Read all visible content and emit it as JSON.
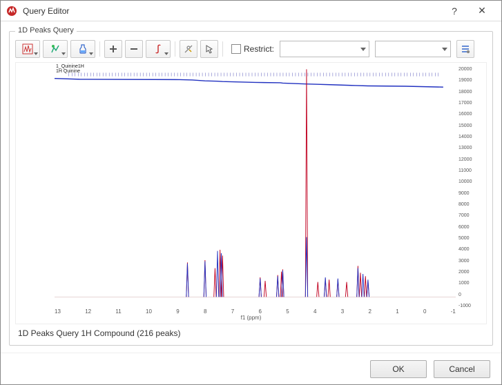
{
  "window": {
    "title": "Query Editor",
    "help_label": "?",
    "close_label": "✕"
  },
  "groupbox": {
    "label": "1D Peaks Query"
  },
  "toolbar": {
    "restrict_label": "Restrict:",
    "combo1_value": "",
    "combo2_value": ""
  },
  "sample": {
    "line1": "1_Quinine1H",
    "line2": "1H Quinine"
  },
  "y_axis_ticks": [
    "20000",
    "19000",
    "18000",
    "17000",
    "16000",
    "15000",
    "14000",
    "13000",
    "12000",
    "11000",
    "10000",
    "9000",
    "8000",
    "7000",
    "6000",
    "5000",
    "4000",
    "3000",
    "2000",
    "1000",
    "0",
    "-1000"
  ],
  "x_axis_ticks": [
    "13",
    "12",
    "11",
    "10",
    "9",
    "8",
    "7",
    "6",
    "5",
    "4",
    "3",
    "2",
    "1",
    "0",
    "-1"
  ],
  "x_axis_label": "f1 (ppm)",
  "status_line": "1D Peaks Query 1H Compound (216 peaks)",
  "footer": {
    "ok": "OK",
    "cancel": "Cancel"
  },
  "icons": {
    "app": "app-logo",
    "spectrum": "spectrum-icon",
    "analyze": "analyze-icon",
    "bottle": "bottle-icon",
    "plus": "plus-icon",
    "minus": "minus-icon",
    "integral": "integral-icon",
    "tools": "tools-icon",
    "cursor": "cursor-icon",
    "list": "list-icon"
  },
  "chart_data": {
    "type": "line",
    "title": "",
    "xlabel": "f1 (ppm)",
    "ylabel": "",
    "xlim": [
      14,
      -2
    ],
    "ylim": [
      -1000,
      20000
    ],
    "series": [
      {
        "name": "1H Quinine (red)",
        "color": "#c00020",
        "peaks": [
          {
            "ppm": 8.7,
            "intensity": 3000
          },
          {
            "ppm": 8.0,
            "intensity": 3200
          },
          {
            "ppm": 7.6,
            "intensity": 2500
          },
          {
            "ppm": 7.4,
            "intensity": 4100
          },
          {
            "ppm": 7.3,
            "intensity": 3600
          },
          {
            "ppm": 5.8,
            "intensity": 1700
          },
          {
            "ppm": 5.6,
            "intensity": 1400
          },
          {
            "ppm": 5.1,
            "intensity": 1900
          },
          {
            "ppm": 4.95,
            "intensity": 2200
          },
          {
            "ppm": 4.9,
            "intensity": 2400
          },
          {
            "ppm": 3.95,
            "intensity": 19800
          },
          {
            "ppm": 3.5,
            "intensity": 1300
          },
          {
            "ppm": 3.2,
            "intensity": 1600
          },
          {
            "ppm": 3.05,
            "intensity": 1500
          },
          {
            "ppm": 2.7,
            "intensity": 1500
          },
          {
            "ppm": 2.35,
            "intensity": 1300
          },
          {
            "ppm": 1.9,
            "intensity": 2700
          },
          {
            "ppm": 1.8,
            "intensity": 2100
          },
          {
            "ppm": 1.6,
            "intensity": 1800
          },
          {
            "ppm": 1.5,
            "intensity": 1400
          }
        ]
      },
      {
        "name": "1_Quinine1H (blue)",
        "color": "#2030c0",
        "peaks": [
          {
            "ppm": 8.7,
            "intensity": 2900
          },
          {
            "ppm": 8.0,
            "intensity": 3100
          },
          {
            "ppm": 7.5,
            "intensity": 4000
          },
          {
            "ppm": 7.35,
            "intensity": 3800
          },
          {
            "ppm": 5.8,
            "intensity": 1600
          },
          {
            "ppm": 5.1,
            "intensity": 1800
          },
          {
            "ppm": 4.9,
            "intensity": 2300
          },
          {
            "ppm": 3.95,
            "intensity": 5200
          },
          {
            "ppm": 3.2,
            "intensity": 1700
          },
          {
            "ppm": 2.7,
            "intensity": 1600
          },
          {
            "ppm": 1.9,
            "intensity": 2500
          },
          {
            "ppm": 1.7,
            "intensity": 2000
          },
          {
            "ppm": 1.5,
            "intensity": 1500
          }
        ]
      }
    ],
    "integral_trace": {
      "color": "#2030c0",
      "baseline_y": 19000
    }
  }
}
